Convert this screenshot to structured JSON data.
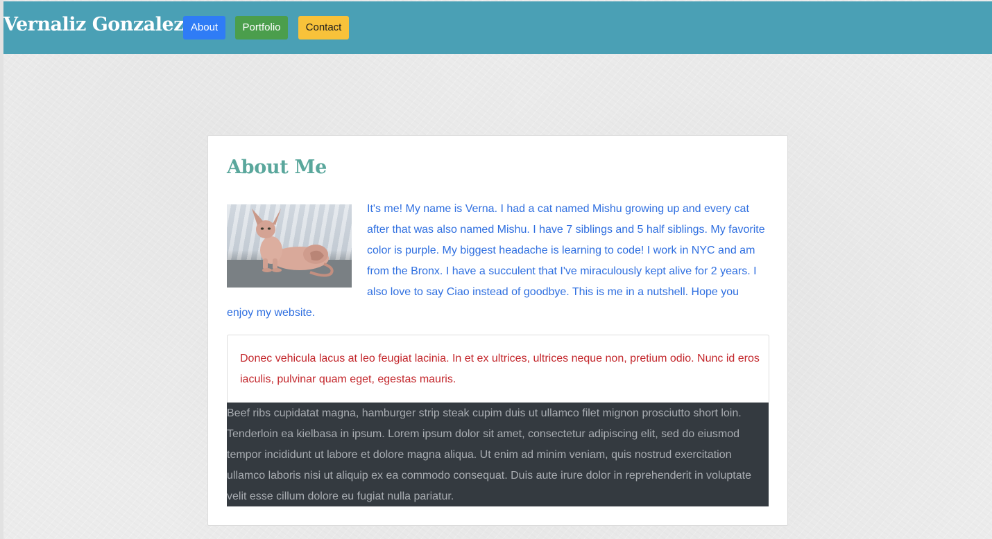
{
  "navbar": {
    "brand": "Vernaliz Gonzalez",
    "buttons": {
      "about": "About",
      "portfolio": "Portfolio",
      "contact": "Contact"
    },
    "background_color": "#4aa0b5",
    "button_colors": {
      "about": "#2f7cf6",
      "portfolio": "#4b9e4c",
      "contact": "#f8c23a"
    }
  },
  "about": {
    "title": "About Me",
    "photo_icon": "hairless-cat-photo",
    "text": "It's me! My name is Verna. I had a cat named Mishu growing up and every cat after that was also named Mishu. I have 7 siblings and 5 half siblings. My favorite color is purple. My biggest headache is learning to code! I work in NYC and am from the Bronx. I have a succulent that I've miraculously kept alive for 2 years. I also love to say Ciao instead of goodbye. This is me in a nutshell. Hope you enjoy my website.",
    "lorem": "Donec vehicula lacus at leo feugiat lacinia. In et ex ultrices, ultrices neque non, pretium odio. Nunc id eros iaculis, pulvinar quam eget, egestas mauris.",
    "dark_text": "Beef ribs cupidatat magna, hamburger strip steak cupim duis ut ullamco filet mignon prosciutto short loin. Tenderloin ea kielbasa in ipsum. Lorem ipsum dolor sit amet, consectetur adipiscing elit, sed do eiusmod tempor incididunt ut labore et dolore magna aliqua. Ut enim ad minim veniam, quis nostrud exercitation ullamco laboris nisi ut aliquip ex ea commodo consequat. Duis aute irure dolor in reprehenderit in voluptate velit esse cillum dolore eu fugiat nulla pariatur.",
    "colors": {
      "title": "#5aa79c",
      "text": "#2f6fe0",
      "lorem": "#c3262b",
      "dark_bg": "#343a40",
      "dark_text": "#a9adb2"
    }
  }
}
